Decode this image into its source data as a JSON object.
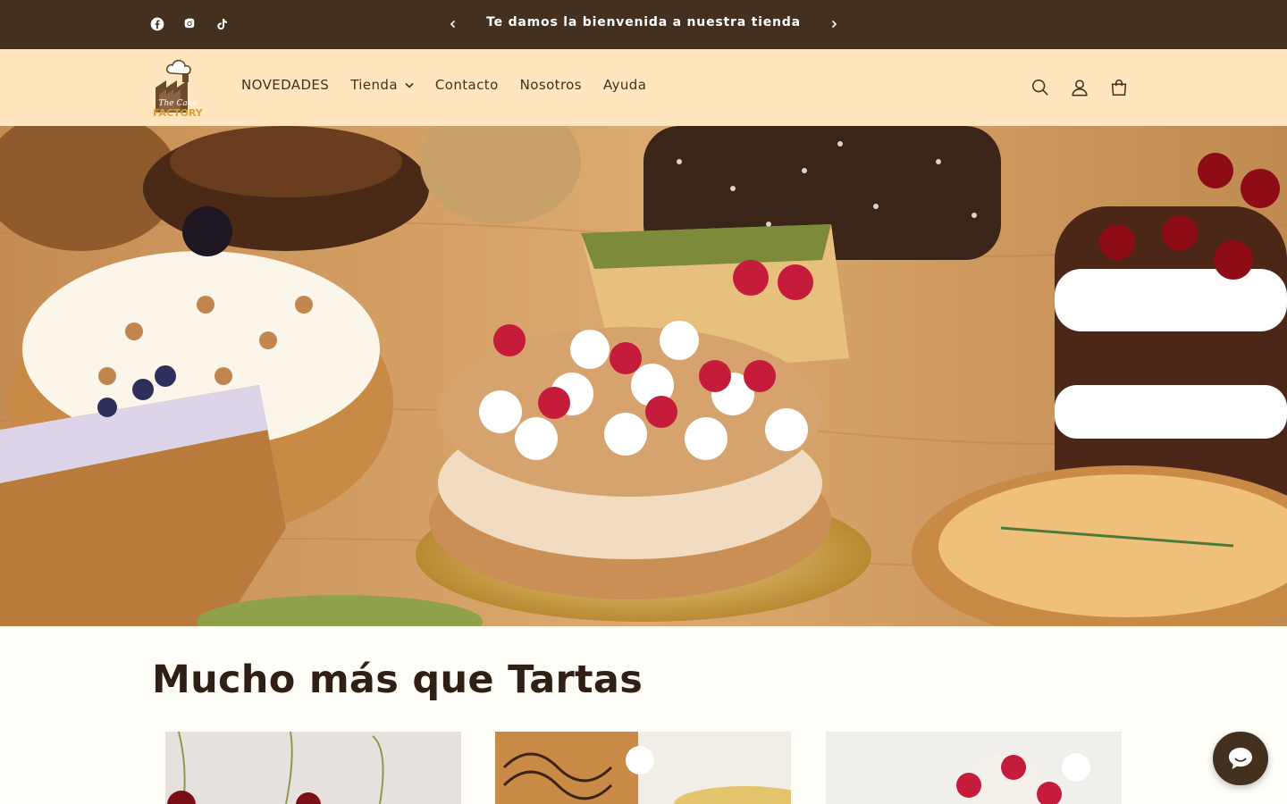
{
  "announcement": {
    "text": "Te damos la bienvenida a nuestra tienda",
    "social_icons": [
      "facebook-icon",
      "instagram-icon",
      "tiktok-icon"
    ],
    "prev_icon": "chevron-left-icon",
    "next_icon": "chevron-right-icon"
  },
  "header": {
    "logo_line1": "The Cake",
    "logo_line2": "FACTORY",
    "nav": [
      {
        "label": "NOVEDADES"
      },
      {
        "label": "Tienda",
        "has_dropdown": true
      },
      {
        "label": "Contacto"
      },
      {
        "label": "Nosotros"
      },
      {
        "label": "Ayuda"
      }
    ],
    "icons": [
      "search-icon",
      "account-icon",
      "cart-icon"
    ]
  },
  "hero": {
    "image": "cakes-on-wooden-table"
  },
  "section": {
    "title": "Mucho más que Tartas",
    "cards": [
      "cherries-card-image",
      "glazed-loaf-card-image",
      "raspberry-cake-card-image"
    ]
  },
  "chat": {
    "icon": "chat-bubble-icon"
  },
  "colors": {
    "announcement_bg": "#43301f",
    "header_bg": "#ffe6bf",
    "page_bg": "#fffdf8",
    "text": "#2f1f14",
    "accent": "#43301f"
  }
}
